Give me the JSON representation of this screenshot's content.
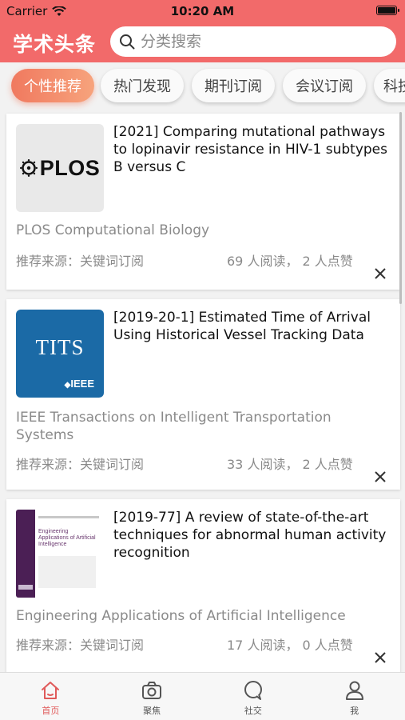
{
  "status_bar": {
    "carrier": "Carrier",
    "time": "10:20 AM"
  },
  "header": {
    "app_title": "学术头条",
    "search_placeholder": "分类搜索"
  },
  "category_tabs": [
    {
      "label": "个性推荐",
      "active": true
    },
    {
      "label": "热门发现",
      "active": false
    },
    {
      "label": "期刊订阅",
      "active": false
    },
    {
      "label": "会议订阅",
      "active": false
    },
    {
      "label": "科技",
      "active": false
    }
  ],
  "articles": [
    {
      "thumb_icon": "plos-logo",
      "thumb_text": "PLOS",
      "title": "[2021] Comparing mutational pathways to lopinavir resistance in HIV-1 subtypes B versus C",
      "journal": "PLOS Computational Biology",
      "source": "推荐来源：关键词订阅",
      "stats": "69 人阅读， 2 人点赞"
    },
    {
      "thumb_icon": "tits-ieee-logo",
      "thumb_text": "TITS",
      "thumb_sub": "IEEE",
      "title": "[2019-20-1] Estimated Time of Arrival Using Historical Vessel Tracking Data",
      "journal": "IEEE Transactions on Intelligent Transportation Systems",
      "source": "推荐来源：关键词订阅",
      "stats": "33 人阅读， 2 人点赞"
    },
    {
      "thumb_icon": "journal-cover-image",
      "thumb_text": "Engineering Applications of Artificial Intelligence",
      "title": "[2019-77] A review of state-of-the-art techniques for abnormal human activity recognition",
      "journal": "Engineering Applications of Artificial Intelligence",
      "source": "推荐来源：关键词订阅",
      "stats": "17 人阅读， 0 人点赞"
    }
  ],
  "bottom_tabs": [
    {
      "label": "首页",
      "icon": "home-icon",
      "active": true
    },
    {
      "label": "聚焦",
      "icon": "camera-icon",
      "active": false
    },
    {
      "label": "社交",
      "icon": "chat-bubble-icon",
      "active": false
    },
    {
      "label": "我",
      "icon": "person-icon",
      "active": false
    }
  ],
  "colors": {
    "brand": "#f26a6a",
    "tab_active_start": "#f0795f",
    "tab_active_end": "#f7a37c",
    "bottom_active": "#e05a5a",
    "muted_text": "#8a8a8a"
  }
}
